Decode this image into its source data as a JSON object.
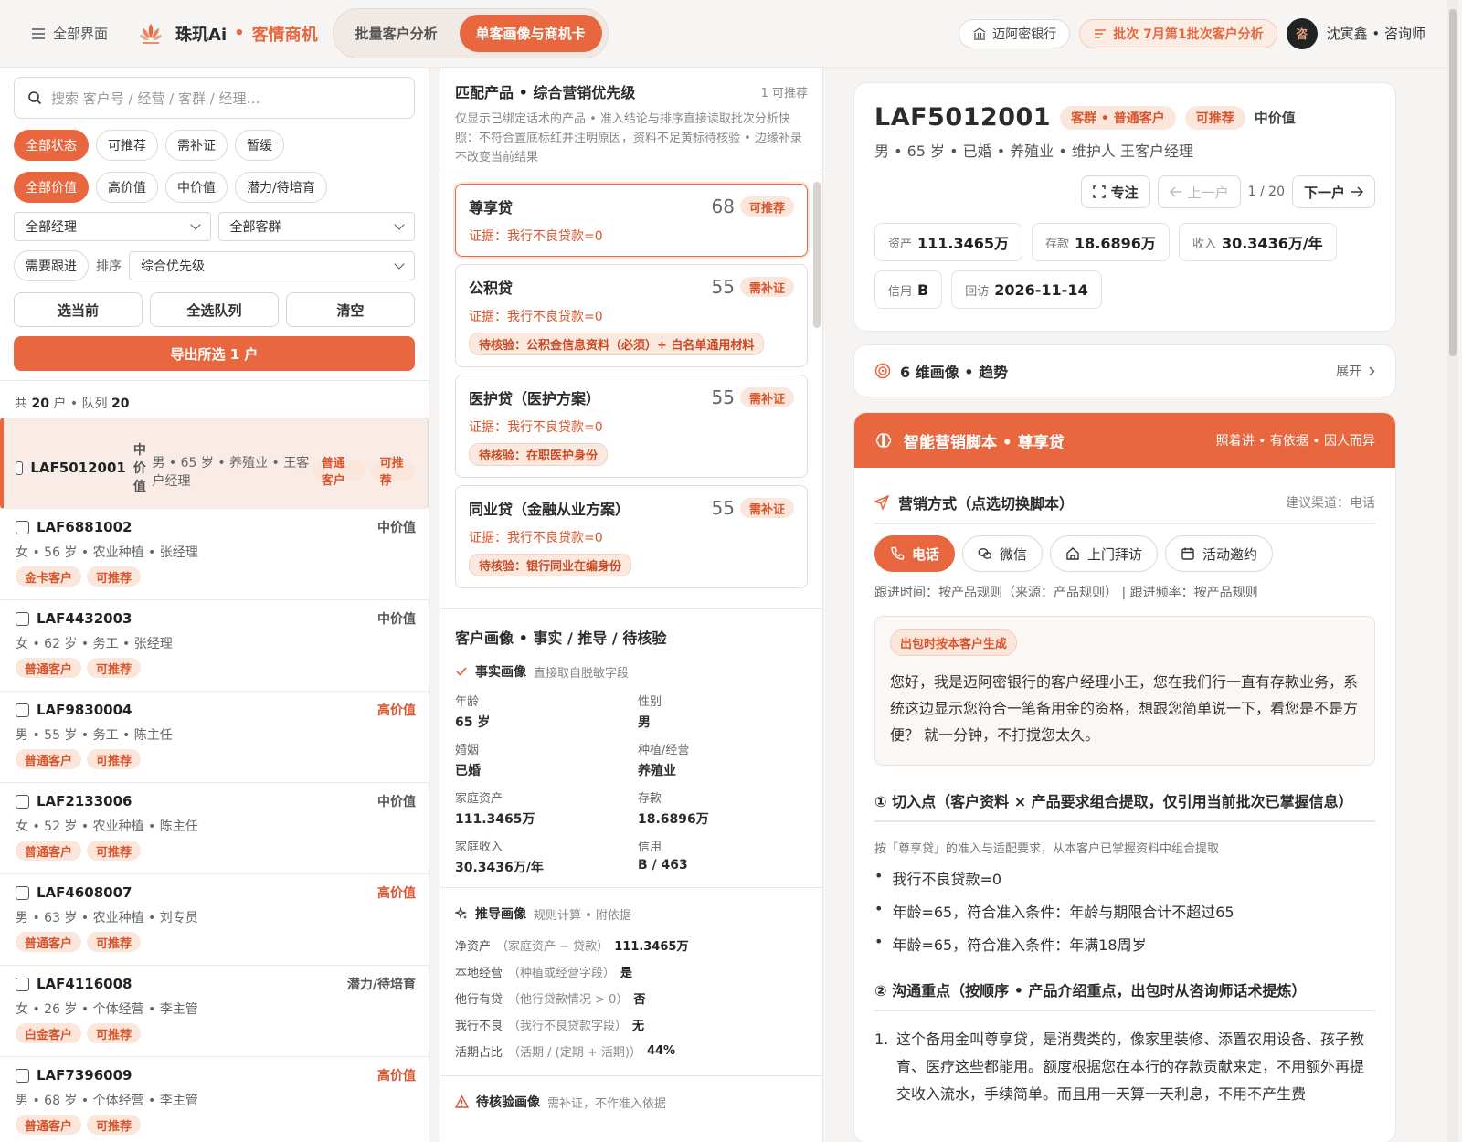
{
  "topbar": {
    "menu_label": "全部界面",
    "brand": "珠玑Ai",
    "brand_dot": "•",
    "brand_sub": "客情商机",
    "tabs": [
      {
        "label": "批量客户分析"
      },
      {
        "label": "单客画像与商机卡"
      }
    ],
    "bank": "迈阿密银行",
    "batch": "批次 7月第1批次客户分析",
    "avatar_char": "咨",
    "user": "沈寅鑫 • 咨询师"
  },
  "colors": {
    "accent": "#e8673f",
    "accent_soft": "#fbe6dc"
  },
  "left": {
    "search_placeholder": "搜索 客户号 / 经营 / 客群 / 经理…",
    "status_chips": [
      "全部状态",
      "可推荐",
      "需补证",
      "暂缓"
    ],
    "value_chips": [
      "全部价值",
      "高价值",
      "中价值",
      "潜力/待培育"
    ],
    "manager_select": "全部经理",
    "group_select": "全部客群",
    "follow_chip": "需要跟进",
    "sort_label": "排序",
    "sort_select": "综合优先级",
    "btn_select_current": "选当前",
    "btn_select_all": "全选队列",
    "btn_clear": "清空",
    "btn_export": "导出所选 1 户",
    "count_prefix": "共",
    "count_total": "20",
    "count_mid": "户 • 队列",
    "count_queue": "20",
    "customers": [
      {
        "id": "LAF5012001",
        "value": "中价值",
        "meta": "男 • 65 岁 • 养殖业 • 王客户经理",
        "tags": [
          "普通客户",
          "可推荐"
        ]
      },
      {
        "id": "LAF6881002",
        "value": "中价值",
        "meta": "女 • 56 岁 • 农业种植 • 张经理",
        "tags": [
          "金卡客户",
          "可推荐"
        ]
      },
      {
        "id": "LAF4432003",
        "value": "中价值",
        "meta": "女 • 62 岁 • 务工 • 张经理",
        "tags": [
          "普通客户",
          "可推荐"
        ]
      },
      {
        "id": "LAF9830004",
        "value": "高价值",
        "meta": "男 • 55 岁 • 务工 • 陈主任",
        "tags": [
          "普通客户",
          "可推荐"
        ]
      },
      {
        "id": "LAF2133006",
        "value": "中价值",
        "meta": "女 • 52 岁 • 农业种植 • 陈主任",
        "tags": [
          "普通客户",
          "可推荐"
        ]
      },
      {
        "id": "LAF4608007",
        "value": "高价值",
        "meta": "男 • 63 岁 • 农业种植 • 刘专员",
        "tags": [
          "普通客户",
          "可推荐"
        ]
      },
      {
        "id": "LAF4116008",
        "value": "潜力/待培育",
        "meta": "女 • 26 岁 • 个体经营 • 李主管",
        "tags": [
          "白金客户",
          "可推荐"
        ]
      },
      {
        "id": "LAF7396009",
        "value": "高价值",
        "meta": "男 • 68 岁 • 个体经营 • 李主管",
        "tags": [
          "普通客户",
          "可推荐"
        ]
      }
    ]
  },
  "mid": {
    "title": "匹配产品 • 综合营销优先级",
    "count": "1 可推荐",
    "desc": "仅显示已绑定话术的产品 • 准入结论与排序直接读取批次分析快照：不符合置底标红并注明原因，资料不足黄标待核验 • 边缘补录不改变当前结果",
    "products": [
      {
        "name": "尊享贷",
        "score": "68",
        "badge": "可推荐",
        "evidence": "证据：我行不良贷款=0",
        "check": ""
      },
      {
        "name": "公积贷",
        "score": "55",
        "badge": "需补证",
        "evidence": "证据：我行不良贷款=0",
        "check": "待核验：公积金信息资料（必须）+ 白名单通用材料"
      },
      {
        "name": "医护贷（医护方案）",
        "score": "55",
        "badge": "需补证",
        "evidence": "证据：我行不良贷款=0",
        "check": "待核验：在职医护身份"
      },
      {
        "name": "同业贷（金融从业方案）",
        "score": "55",
        "badge": "需补证",
        "evidence": "证据：我行不良贷款=0",
        "check": "待核验：银行同业在编身份"
      }
    ],
    "portrait_title": "客户画像 • 事实 / 推导 / 待核验",
    "fact_title": "事实画像",
    "fact_hint": "直接取自脱敏字段",
    "facts": [
      {
        "k": "年龄",
        "v": "65 岁"
      },
      {
        "k": "性别",
        "v": "男"
      },
      {
        "k": "婚姻",
        "v": "已婚"
      },
      {
        "k": "种植/经营",
        "v": "养殖业"
      },
      {
        "k": "家庭资产",
        "v": "111.3465万"
      },
      {
        "k": "存款",
        "v": "18.6896万"
      },
      {
        "k": "家庭收入",
        "v": "30.3436万/年"
      },
      {
        "k": "信用",
        "v": "B / 463"
      }
    ],
    "derive_title": "推导画像",
    "derive_hint": "规则计算 • 附依据",
    "derived": [
      {
        "k": "净资产",
        "hint": "（家庭资产 − 贷款）",
        "v": "111.3465万"
      },
      {
        "k": "本地经营",
        "hint": "（种植或经营字段）",
        "v": "是"
      },
      {
        "k": "他行有贷",
        "hint": "（他行贷款情况 > 0）",
        "v": "否"
      },
      {
        "k": "我行不良",
        "hint": "（我行不良贷款字段）",
        "v": "无"
      },
      {
        "k": "活期占比",
        "hint": "（活期 / (定期 + 活期)）",
        "v": "44%"
      }
    ],
    "verify_title": "待核验画像",
    "verify_hint": "需补证，不作准入依据"
  },
  "right": {
    "id": "LAF5012001",
    "group_tag": "客群 • 普通客户",
    "rec_tag": "可推荐",
    "value": "中价值",
    "meta": "男 • 65 岁 • 已婚 • 养殖业 • 维护人 王客户经理",
    "focus": "专注",
    "prev": "上一户",
    "page": "1 / 20",
    "next": "下一户",
    "stats": [
      {
        "k": "资产",
        "v": "111.3465万"
      },
      {
        "k": "存款",
        "v": "18.6896万"
      },
      {
        "k": "收入",
        "v": "30.3436万/年"
      },
      {
        "k": "信用",
        "v": "B"
      },
      {
        "k": "回访",
        "v": "2026-11-14"
      }
    ],
    "dims": "6 维画像 • 趋势",
    "expand": "展开",
    "script_title": "智能营销脚本 • 尊享贷",
    "script_sub": "照着讲 • 有依据 • 因人而异",
    "method_title": "营销方式（点选切换脚本）",
    "method_hint": "建议渠道：电话",
    "channels": [
      {
        "label": "电话",
        "icon": "phone-icon"
      },
      {
        "label": "微信",
        "icon": "wechat-icon"
      },
      {
        "label": "上门拜访",
        "icon": "home-icon"
      },
      {
        "label": "活动邀约",
        "icon": "calendar-icon"
      }
    ],
    "followup": "跟进时间：按产品规则（来源：产品规则） | 跟进频率：按产品规则",
    "gen_tag": "出包时按本客户生成",
    "script_text": "您好，我是迈阿密银行的客户经理小王，您在我们行一直有存款业务，系统这边显示您符合一笔备用金的资格，想跟您简单说一下，看您是不是方便？ 就一分钟，不打搅您太久。",
    "entry_title": "① 切入点（客户资料 × 产品要求组合提取，仅引用当前批次已掌握信息）",
    "entry_note": "按「尊享贷」的准入与适配要求，从本客户已掌握资料中组合提取",
    "entry_points": [
      "我行不良贷款=0",
      "年龄=65，符合准入条件：年龄与期限合计不超过65",
      "年龄=65，符合准入条件：年满18周岁"
    ],
    "focus_title": "② 沟通重点（按顺序 • 产品介绍重点，出包时从咨询师话术提炼）",
    "focus_points": [
      "这个备用金叫尊享贷，是消费类的，像家里装修、添置农用设备、孩子教育、医疗这些都能用。额度根据您在本行的存款贡献来定，不用额外再提交收入流水，手续简单。而且用一天算一天利息，不用不产生费"
    ]
  }
}
